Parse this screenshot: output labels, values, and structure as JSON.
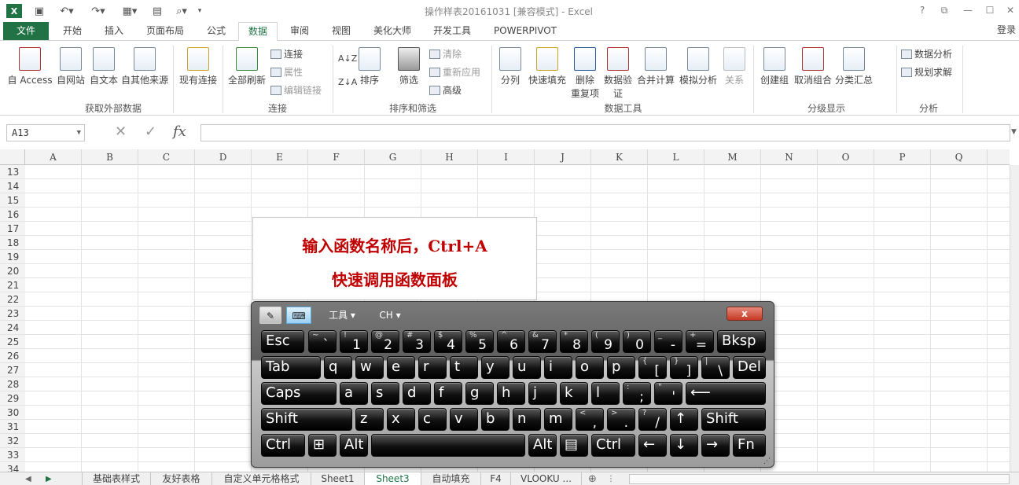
{
  "titlebar": {
    "title": "操作样表20161031  [兼容模式] - Excel",
    "help": "?",
    "restore_ribbon": "⧉",
    "minimize": "—",
    "maximize": "☐",
    "close": "✕"
  },
  "tabs": {
    "file": "文件",
    "items": [
      "开始",
      "插入",
      "页面布局",
      "公式",
      "数据",
      "审阅",
      "视图",
      "美化大师",
      "开发工具",
      "POWERPIVOT"
    ],
    "active": "数据",
    "login": "登录"
  },
  "ribbon": {
    "groups": {
      "external": "获取外部数据",
      "connections": "连接",
      "sortfilter": "排序和筛选",
      "datatools": "数据工具",
      "outline": "分级显示",
      "analysis": "分析"
    },
    "buttons": {
      "access": "自 Access",
      "web": "自网站",
      "text": "自文本",
      "other": "自其他来源",
      "existing": "现有连接",
      "refresh_all": "全部刷新",
      "connections": "连接",
      "properties": "属性",
      "edit_links": "编辑链接",
      "sort": "排序",
      "filter": "筛选",
      "clear": "清除",
      "reapply": "重新应用",
      "advanced": "高级",
      "text_to_columns": "分列",
      "flash_fill": "快速填充",
      "remove_dup_1": "删除",
      "remove_dup_2": "重复项",
      "validation_1": "数据验",
      "validation_2": "证",
      "consolidate": "合并计算",
      "whatif": "模拟分析",
      "relationships": "关系",
      "group": "创建组",
      "ungroup": "取消组合",
      "subtotal": "分类汇总",
      "data_analysis": "数据分析",
      "solver": "规划求解"
    }
  },
  "formula_bar": {
    "name_box": "A13",
    "cancel": "✕",
    "enter": "✓",
    "fx": "fx",
    "formula": ""
  },
  "grid": {
    "columns": [
      "A",
      "B",
      "C",
      "D",
      "E",
      "F",
      "G",
      "H",
      "I",
      "J",
      "K",
      "L",
      "M",
      "N",
      "O",
      "P",
      "Q"
    ],
    "rows": [
      "13",
      "14",
      "15",
      "16",
      "17",
      "18",
      "19",
      "20",
      "21",
      "22",
      "23",
      "24",
      "25",
      "26",
      "27",
      "28",
      "29",
      "30",
      "31",
      "32",
      "33",
      "34"
    ]
  },
  "callout": {
    "line1": "输入函数名称后，Ctrl+A",
    "line2": "快速调用函数面板"
  },
  "osk": {
    "tools_label": "工具",
    "lang_label": "CH",
    "close": "x",
    "rows": [
      [
        {
          "m": "Esc"
        },
        {
          "s": "~",
          "m": "`"
        },
        {
          "s": "!",
          "m": "1"
        },
        {
          "s": "@",
          "m": "2"
        },
        {
          "s": "#",
          "m": "3"
        },
        {
          "s": "$",
          "m": "4"
        },
        {
          "s": "%",
          "m": "5"
        },
        {
          "s": "^",
          "m": "6"
        },
        {
          "s": "&",
          "m": "7"
        },
        {
          "s": "*",
          "m": "8"
        },
        {
          "s": "(",
          "m": "9"
        },
        {
          "s": ")",
          "m": "0"
        },
        {
          "s": "_",
          "m": "-"
        },
        {
          "s": "+",
          "m": "="
        },
        {
          "m": "Bksp"
        }
      ],
      [
        {
          "m": "Tab"
        },
        {
          "m": "q"
        },
        {
          "m": "w"
        },
        {
          "m": "e"
        },
        {
          "m": "r"
        },
        {
          "m": "t"
        },
        {
          "m": "y"
        },
        {
          "m": "u"
        },
        {
          "m": "i"
        },
        {
          "m": "o"
        },
        {
          "m": "p"
        },
        {
          "s": "{",
          "m": "["
        },
        {
          "s": "}",
          "m": "]"
        },
        {
          "s": "|",
          "m": "\\"
        },
        {
          "m": "Del"
        }
      ],
      [
        {
          "m": "Caps"
        },
        {
          "m": "a"
        },
        {
          "m": "s"
        },
        {
          "m": "d"
        },
        {
          "m": "f"
        },
        {
          "m": "g"
        },
        {
          "m": "h"
        },
        {
          "m": "j"
        },
        {
          "m": "k"
        },
        {
          "m": "l"
        },
        {
          "s": ":",
          "m": ";"
        },
        {
          "s": "\"",
          "m": "'"
        },
        {
          "m": "⟵"
        }
      ],
      [
        {
          "m": "Shift"
        },
        {
          "m": "z"
        },
        {
          "m": "x"
        },
        {
          "m": "c"
        },
        {
          "m": "v"
        },
        {
          "m": "b"
        },
        {
          "m": "n"
        },
        {
          "m": "m"
        },
        {
          "s": "<",
          "m": ","
        },
        {
          "s": ">",
          "m": "."
        },
        {
          "s": "?",
          "m": "/"
        },
        {
          "m": "↑"
        },
        {
          "m": "Shift"
        }
      ],
      [
        {
          "m": "Ctrl"
        },
        {
          "m": "⊞"
        },
        {
          "m": "Alt"
        },
        {
          "m": ""
        },
        {
          "m": "Alt"
        },
        {
          "m": "▤"
        },
        {
          "m": "Ctrl"
        },
        {
          "m": "←"
        },
        {
          "m": "↓"
        },
        {
          "m": "→"
        },
        {
          "m": "Fn"
        }
      ]
    ]
  },
  "sheets": {
    "items": [
      "基础表样式",
      "友好表格",
      "自定义单元格格式",
      "Sheet1",
      "Sheet3",
      "自动填充",
      "F4",
      "VLOOKU ..."
    ],
    "active": "Sheet3",
    "add": "⊕"
  },
  "colors": {
    "excel_green": "#217346",
    "callout_red": "#c00000"
  }
}
